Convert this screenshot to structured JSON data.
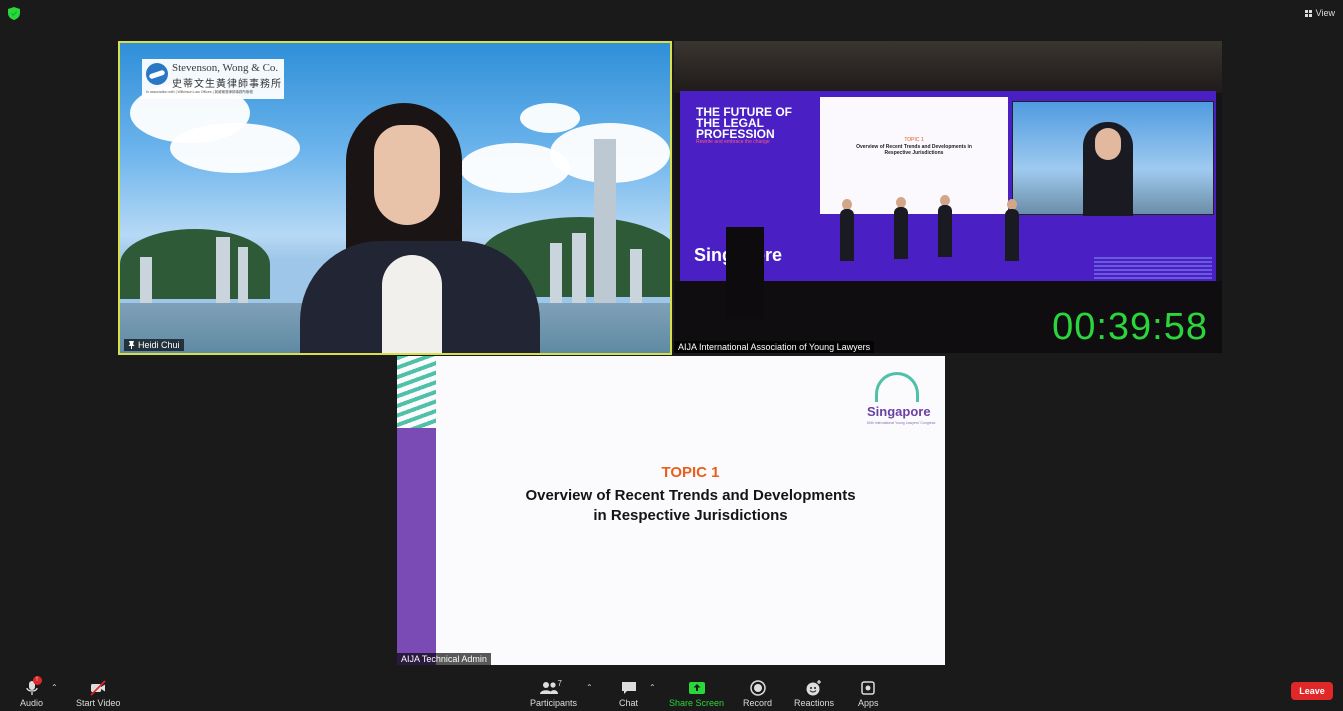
{
  "window": {
    "view_label": "View"
  },
  "tiles": [
    {
      "name": "Heidi Chui",
      "logo_en": "Stevenson, Wong & Co.",
      "logo_zh": "史蒂文生黃律師事務所",
      "logo_sub": "In association with | Wilkinson Law Offices | 與威爾遜律師事務所聯營"
    },
    {
      "name": "AIJA International Association of Young Lawyers",
      "timer": "00:39:58",
      "stage_heading": "THE FUTURE OF THE LEGAL PROFESSION",
      "stage_subheading": "Rewrite and embrace the change",
      "stage_brand": "Singapore",
      "slide_topic": "TOPIC 1",
      "slide_title": "Overview of Recent Trends and Developments in Respective Jurisdictions"
    },
    {
      "name": "AIJA Technical Admin",
      "topic": "TOPIC 1",
      "title_line1": "Overview of Recent Trends and Developments",
      "title_line2": "in Respective Jurisdictions",
      "logo_text": "Singapore",
      "logo_sub": "60th International Young Lawyers' Congress"
    }
  ],
  "toolbar": {
    "audio": "Audio",
    "audio_badge": "!",
    "video": "Start Video",
    "participants": "Participants",
    "participants_count": "7",
    "chat": "Chat",
    "share": "Share Screen",
    "record": "Record",
    "reactions": "Reactions",
    "apps": "Apps",
    "leave": "Leave"
  },
  "colors": {
    "active_speaker_border": "#d7e04a",
    "timer": "#2bd63b",
    "share_green": "#2bd63b",
    "leave_red": "#e02828",
    "topic_orange": "#e8601c",
    "stripe_purple": "#7a4bb4"
  }
}
